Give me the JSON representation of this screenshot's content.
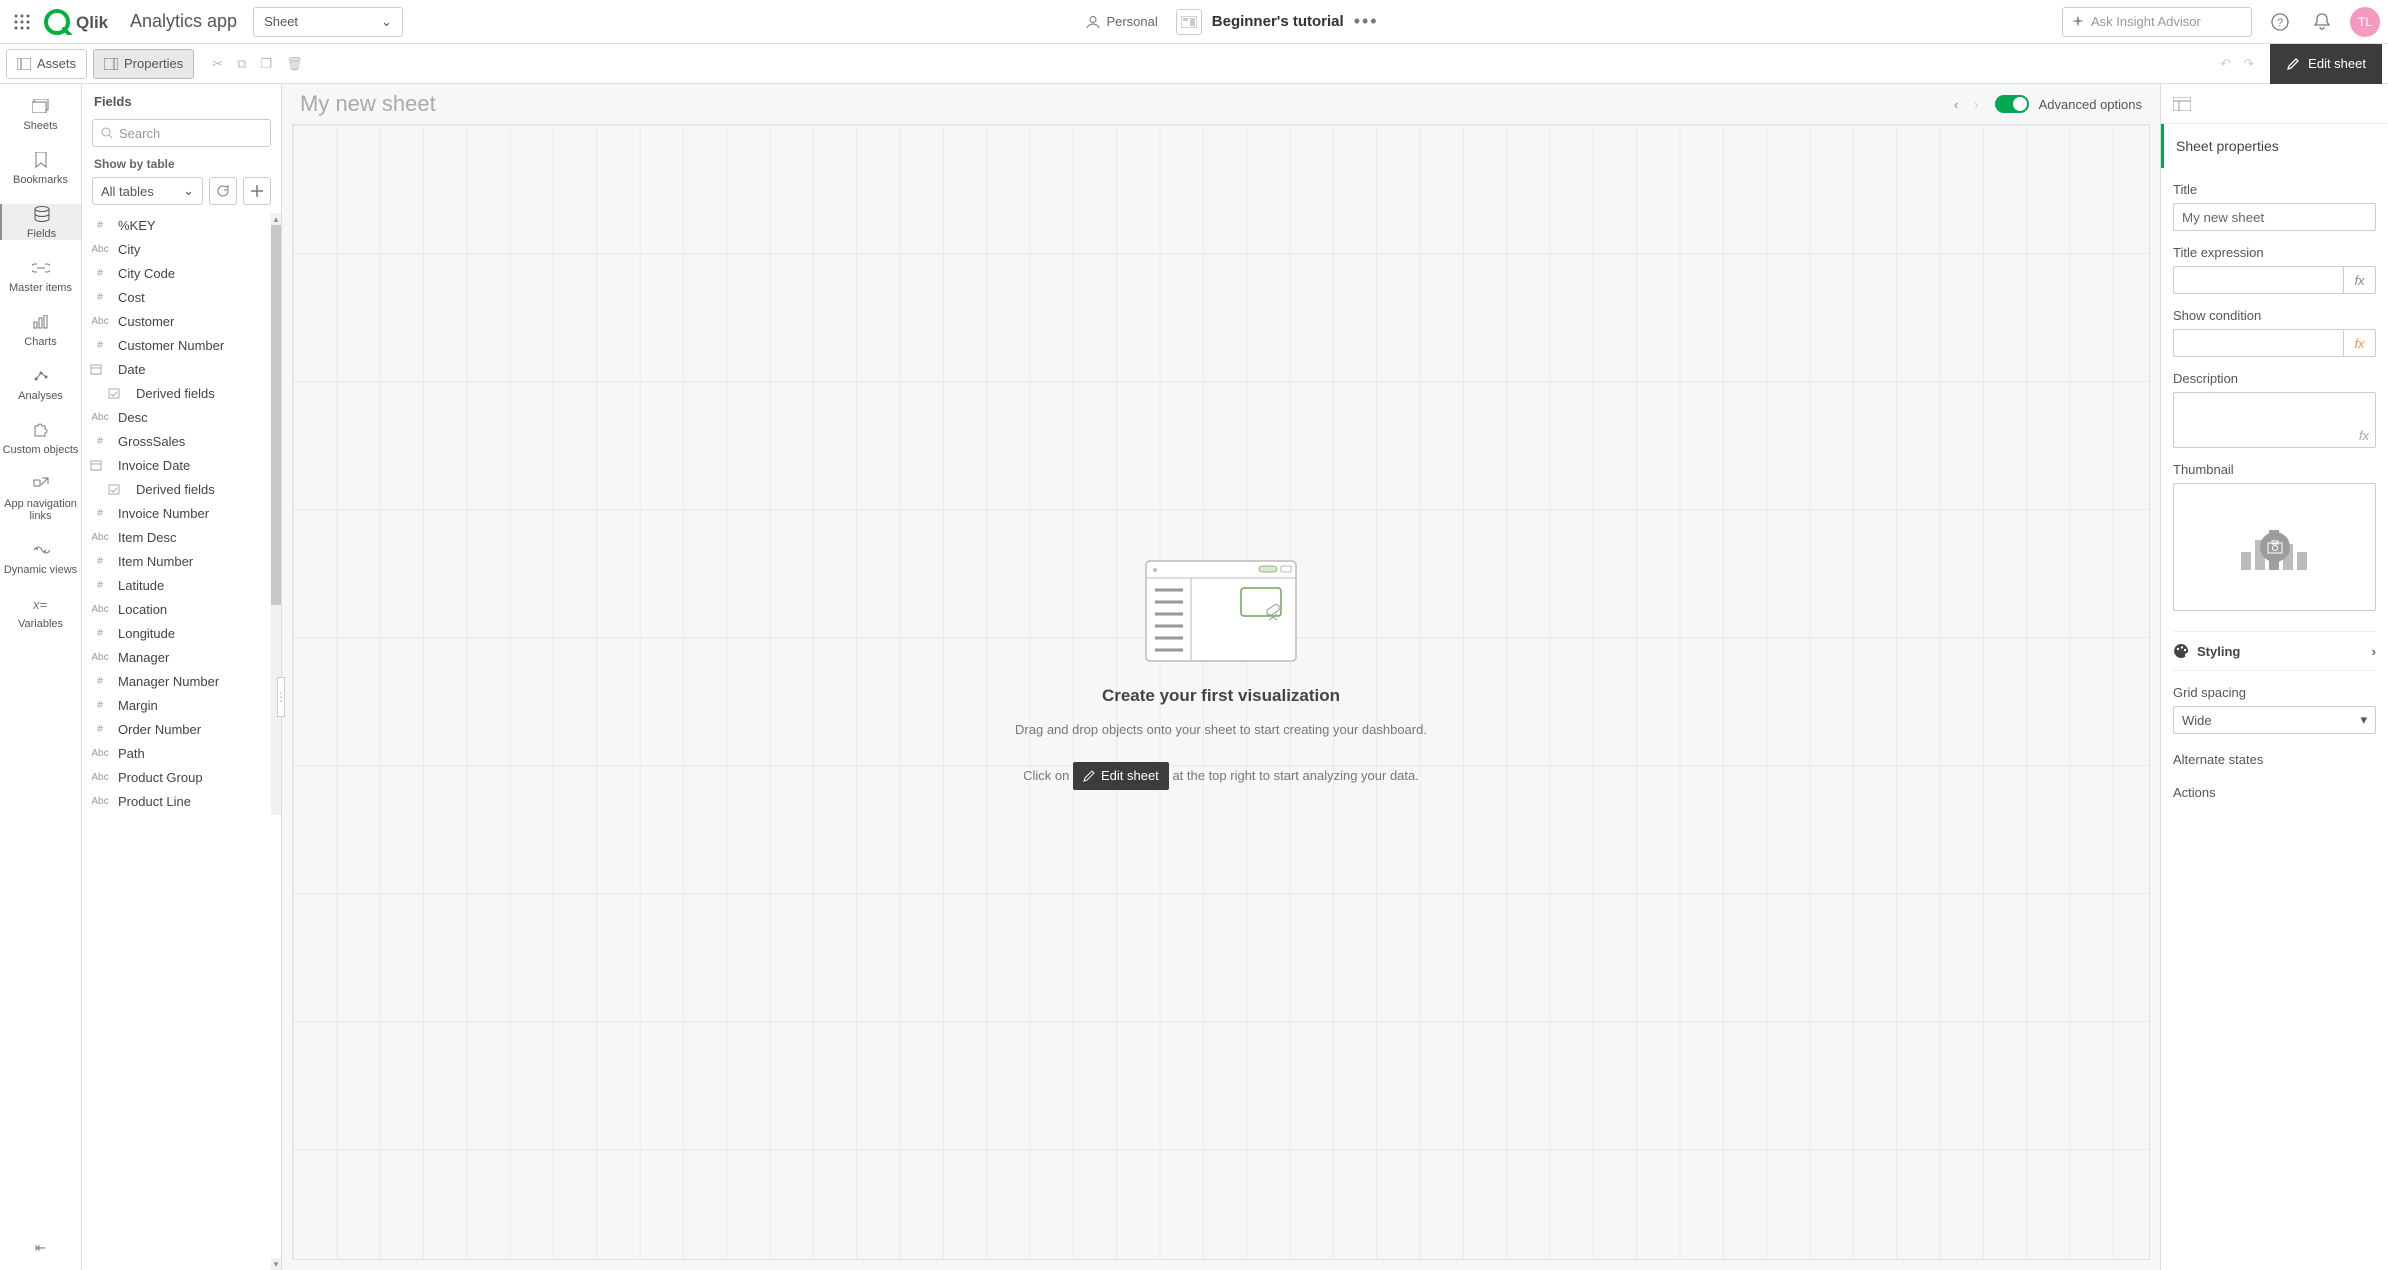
{
  "header": {
    "app_title": "Analytics app",
    "sheet_dropdown": "Sheet",
    "personal": "Personal",
    "breadcrumb": "Beginner's tutorial",
    "insight_placeholder": "Ask Insight Advisor",
    "avatar": "TL"
  },
  "toolbar": {
    "assets": "Assets",
    "properties": "Properties",
    "edit_sheet": "Edit sheet"
  },
  "rail": {
    "items": [
      "Sheets",
      "Bookmarks",
      "Fields",
      "Master items",
      "Charts",
      "Analyses",
      "Custom objects",
      "App navigation links",
      "Dynamic views",
      "Variables"
    ],
    "active_index": 2
  },
  "fields_panel": {
    "title": "Fields",
    "search_placeholder": "Search",
    "show_by": "Show by table",
    "table_select": "All tables",
    "fields": [
      {
        "type": "#",
        "name": "%KEY"
      },
      {
        "type": "Abc",
        "name": "City"
      },
      {
        "type": "#",
        "name": "City Code"
      },
      {
        "type": "#",
        "name": "Cost"
      },
      {
        "type": "Abc",
        "name": "Customer"
      },
      {
        "type": "#",
        "name": "Customer Number"
      },
      {
        "type": "date",
        "name": "Date"
      },
      {
        "type": "derived",
        "name": "Derived fields",
        "indent": true
      },
      {
        "type": "Abc",
        "name": "Desc"
      },
      {
        "type": "#",
        "name": "GrossSales"
      },
      {
        "type": "date",
        "name": "Invoice Date"
      },
      {
        "type": "derived",
        "name": "Derived fields",
        "indent": true
      },
      {
        "type": "#",
        "name": "Invoice Number"
      },
      {
        "type": "Abc",
        "name": "Item Desc"
      },
      {
        "type": "#",
        "name": "Item Number"
      },
      {
        "type": "#",
        "name": "Latitude"
      },
      {
        "type": "Abc",
        "name": "Location"
      },
      {
        "type": "#",
        "name": "Longitude"
      },
      {
        "type": "Abc",
        "name": "Manager"
      },
      {
        "type": "#",
        "name": "Manager Number"
      },
      {
        "type": "#",
        "name": "Margin"
      },
      {
        "type": "#",
        "name": "Order Number"
      },
      {
        "type": "Abc",
        "name": "Path"
      },
      {
        "type": "Abc",
        "name": "Product Group"
      },
      {
        "type": "Abc",
        "name": "Product Line"
      }
    ]
  },
  "canvas": {
    "sheet_title": "My new sheet",
    "advanced_label": "Advanced options",
    "empty_title": "Create your first visualization",
    "empty_line1": "Drag and drop objects onto your sheet to start creating your dashboard.",
    "empty_prefix": "Click on",
    "empty_btn": "Edit sheet",
    "empty_suffix": "at the top right to start analyzing your data."
  },
  "props": {
    "section": "Sheet properties",
    "title_label": "Title",
    "title_value": "My new sheet",
    "title_expr_label": "Title expression",
    "show_cond_label": "Show condition",
    "desc_label": "Description",
    "thumb_label": "Thumbnail",
    "styling": "Styling",
    "grid_label": "Grid spacing",
    "grid_value": "Wide",
    "alternate": "Alternate states",
    "actions": "Actions"
  }
}
